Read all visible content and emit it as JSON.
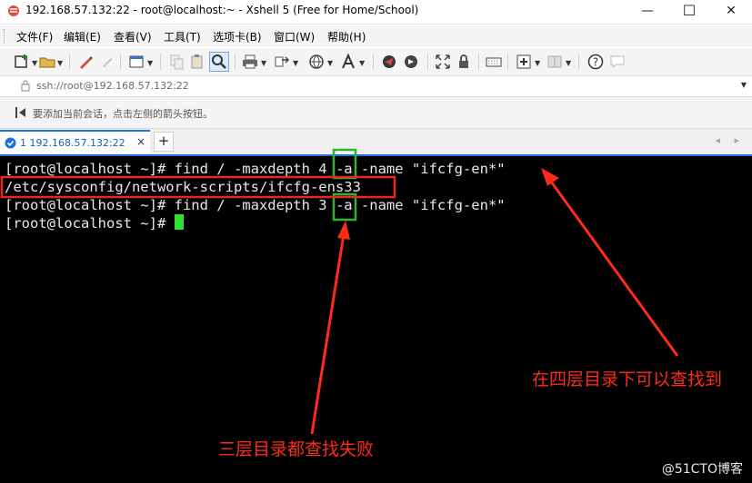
{
  "window": {
    "title": "192.168.57.132:22 - root@localhost:~ - Xshell 5 (Free for Home/School)",
    "minimize_glyph": "—",
    "maximize_glyph": "☐",
    "close_glyph": "✕"
  },
  "menu": [
    "文件(F)",
    "编辑(E)",
    "查看(V)",
    "工具(T)",
    "选项卡(B)",
    "窗口(W)",
    "帮助(H)"
  ],
  "address": {
    "text": "ssh://root@192.168.57.132:22",
    "dropdown_glyph": "▼"
  },
  "hint": {
    "text": "要添加当前会话，点击左侧的箭头按钮。"
  },
  "tabs": [
    {
      "label": "1 192.168.57.132:22",
      "close_glyph": "×",
      "active": true
    }
  ],
  "new_tab_glyph": "+",
  "tab_nav": "◂ ▸",
  "terminal": {
    "lines": [
      "[root@localhost ~]# find / -maxdepth 4 -a -name \"ifcfg-en*\"",
      "/etc/sysconfig/network-scripts/ifcfg-ens33",
      "[root@localhost ~]# find / -maxdepth 3 -a -name \"ifcfg-en*\"",
      "[root@localhost ~]# "
    ]
  },
  "annotations": {
    "found_at_depth_4": "在四层目录下可以查找到",
    "fail_at_depth_3": "三层目录都查找失败"
  },
  "watermark": "@51CTO博客",
  "colors": {
    "annotation_red": "#ff2a1a",
    "highlight_green": "#2fb52f",
    "terminal_bg": "#000000",
    "terminal_fg": "#e8e8e8",
    "cursor": "#2fe02f",
    "tab_accent": "#1e6fd0"
  },
  "icons": [
    "xshell-logo-icon",
    "new-session-icon",
    "open-folder-icon",
    "pen-icon",
    "pencil-icon",
    "properties-icon",
    "copy-icon",
    "paste-icon",
    "find-icon",
    "print-icon",
    "transfer-icon",
    "globe-icon",
    "font-icon",
    "xftp-icon",
    "script-icon",
    "fullscreen-icon",
    "lock-icon",
    "keyboard-icon",
    "add-icon",
    "layout-icon",
    "help-icon",
    "chat-icon"
  ]
}
